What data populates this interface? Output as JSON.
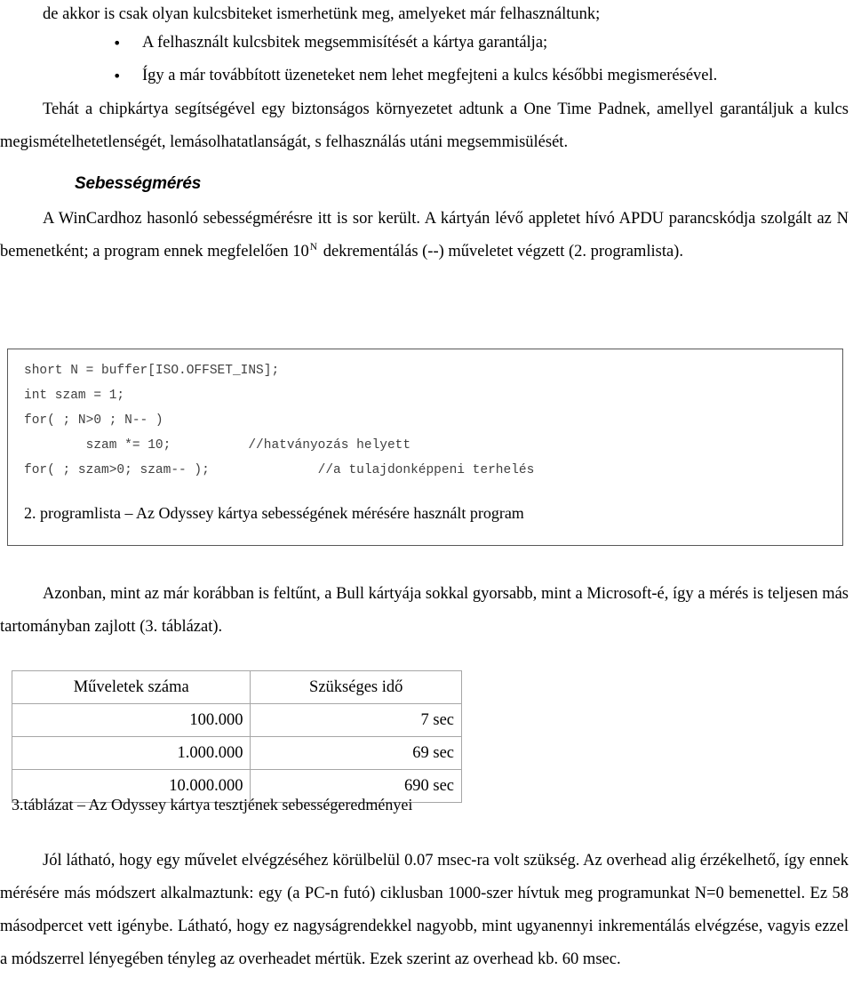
{
  "document": {
    "lead_line": "de akkor is csak olyan kulcsbiteket ismerhetünk meg, amelyeket már felhasználtunk;",
    "bullets": [
      "A felhasznált kulcsbitek megsemmisítését a kártya garantálja;",
      "Így a már továbbított üzeneteket nem lehet megfejteni a kulcs későbbi megismerésével."
    ],
    "paragraph_after_bullets": "Tehát a chipkártya segítségével egy biztonságos környezetet adtunk a One Time Padnek, amellyel garantáljuk a kulcs megismételhetetlenségét, lemásolhatatlanságát, s felhasználás utáni megsemmisülését.",
    "section_heading": "Sebességmérés",
    "speed_paragraph": {
      "part1": "A WinCardhoz hasonló sebességmérésre itt is sor került. A kártyán lévő appletet hívó APDU parancskódja szolgált az N bemenetként; a program ennek megfelelően 10",
      "exponent": "N",
      "part2": " dekrementálás (--) műveletet végzett (2. programlista)."
    },
    "code_block": {
      "lines": [
        "short N = buffer[ISO.OFFSET_INS];",
        "int szam = 1;",
        "for( ; N>0 ; N-- )",
        "        szam *= 10;          //hatványozás helyett",
        "for( ; szam>0; szam-- );              //a tulajdonképpeni terhelés"
      ],
      "caption": "2. programlista – Az Odyssey kártya sebességének mérésére használt program"
    },
    "table_intro": "Azonban, mint az már korábban is feltűnt, a Bull kártyája sokkal gyorsabb, mint a Microsoft-é, így a mérés is teljesen más tartományban zajlott (3. táblázat).",
    "table": {
      "headers": [
        "Műveletek száma",
        "Szükséges idő"
      ],
      "rows": [
        [
          "100.000",
          "7 sec"
        ],
        [
          "1.000.000",
          "69 sec"
        ],
        [
          "10.000.000",
          "690 sec"
        ]
      ],
      "caption": "3.táblázat – Az Odyssey kártya tesztjének sebességeredményei"
    },
    "closing_paragraph": "Jól látható, hogy egy művelet elvégzéséhez körülbelül 0.07 msec-ra volt szükség. Az overhead alig érzékelhető, így ennek mérésére más módszert alkalmaztunk: egy (a PC-n futó) ciklusban 1000-szer hívtuk meg programunkat N=0 bemenettel. Ez 58 másodpercet vett igénybe. Látható, hogy ez nagyságrendekkel nagyobb, mint ugyanennyi inkrementálás elvégzése, vagyis ezzel a módszerrel lényegében tényleg az overheadet mértük. Ezek szerint az overhead kb. 60 msec.",
    "bullet_glyph": "•"
  }
}
